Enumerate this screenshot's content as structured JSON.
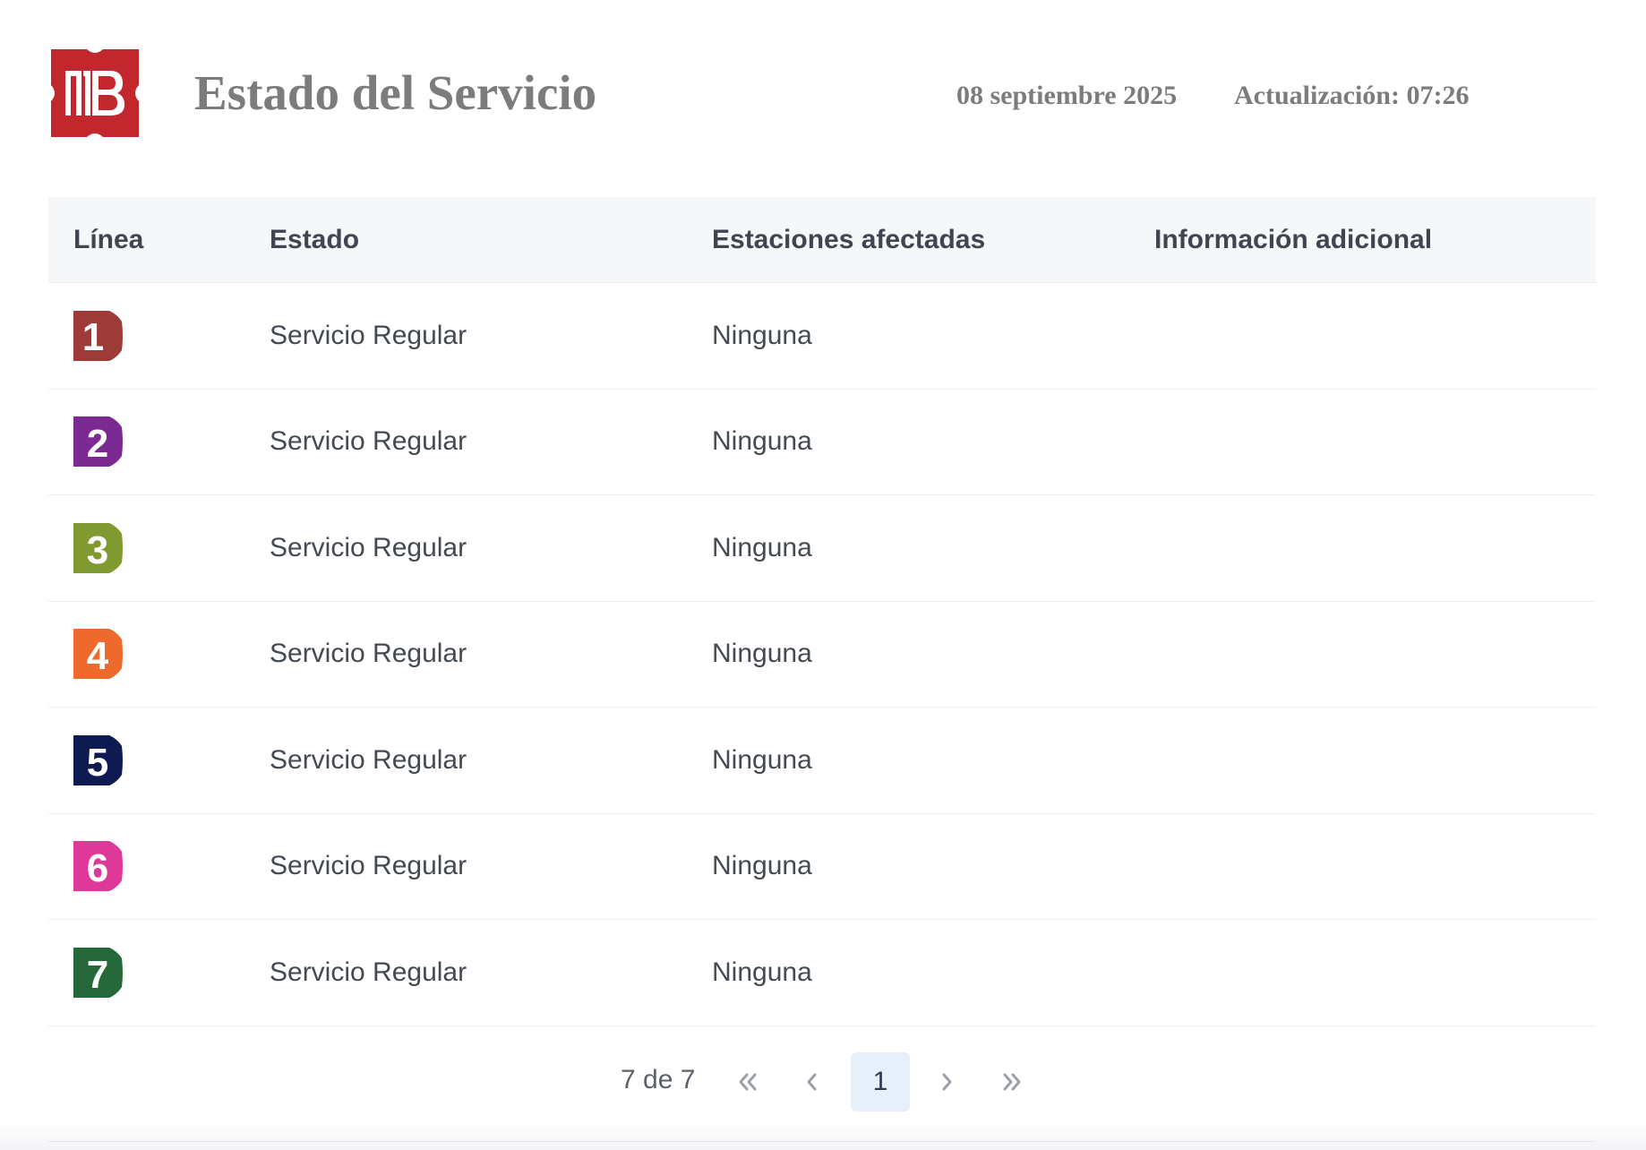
{
  "header": {
    "logo_icon": "metrobus-logo-icon",
    "logo_color": "#c1272d",
    "title": "Estado del Servicio",
    "date": "08 septiembre 2025",
    "update": "Actualización: 07:26"
  },
  "table": {
    "headers": {
      "line": "Línea",
      "status": "Estado",
      "stations": "Estaciones afectadas",
      "info": "Información adicional"
    },
    "rows": [
      {
        "line": "1",
        "color": "#9e3a37",
        "status": "Servicio Regular",
        "stations": "Ninguna",
        "info": ""
      },
      {
        "line": "2",
        "color": "#7b2a92",
        "status": "Servicio Regular",
        "stations": "Ninguna",
        "info": ""
      },
      {
        "line": "3",
        "color": "#7f9a30",
        "status": "Servicio Regular",
        "stations": "Ninguna",
        "info": ""
      },
      {
        "line": "4",
        "color": "#ee6a2c",
        "status": "Servicio Regular",
        "stations": "Ninguna",
        "info": ""
      },
      {
        "line": "5",
        "color": "#0e1a52",
        "status": "Servicio Regular",
        "stations": "Ninguna",
        "info": ""
      },
      {
        "line": "6",
        "color": "#de3998",
        "status": "Servicio Regular",
        "stations": "Ninguna",
        "info": ""
      },
      {
        "line": "7",
        "color": "#25683a",
        "status": "Servicio Regular",
        "stations": "Ninguna",
        "info": ""
      }
    ]
  },
  "pagination": {
    "count_text": "7 de 7",
    "current_page": "1",
    "first_icon": "double-chevron-left-icon",
    "prev_icon": "chevron-left-icon",
    "next_icon": "chevron-right-icon",
    "last_icon": "double-chevron-right-icon"
  }
}
